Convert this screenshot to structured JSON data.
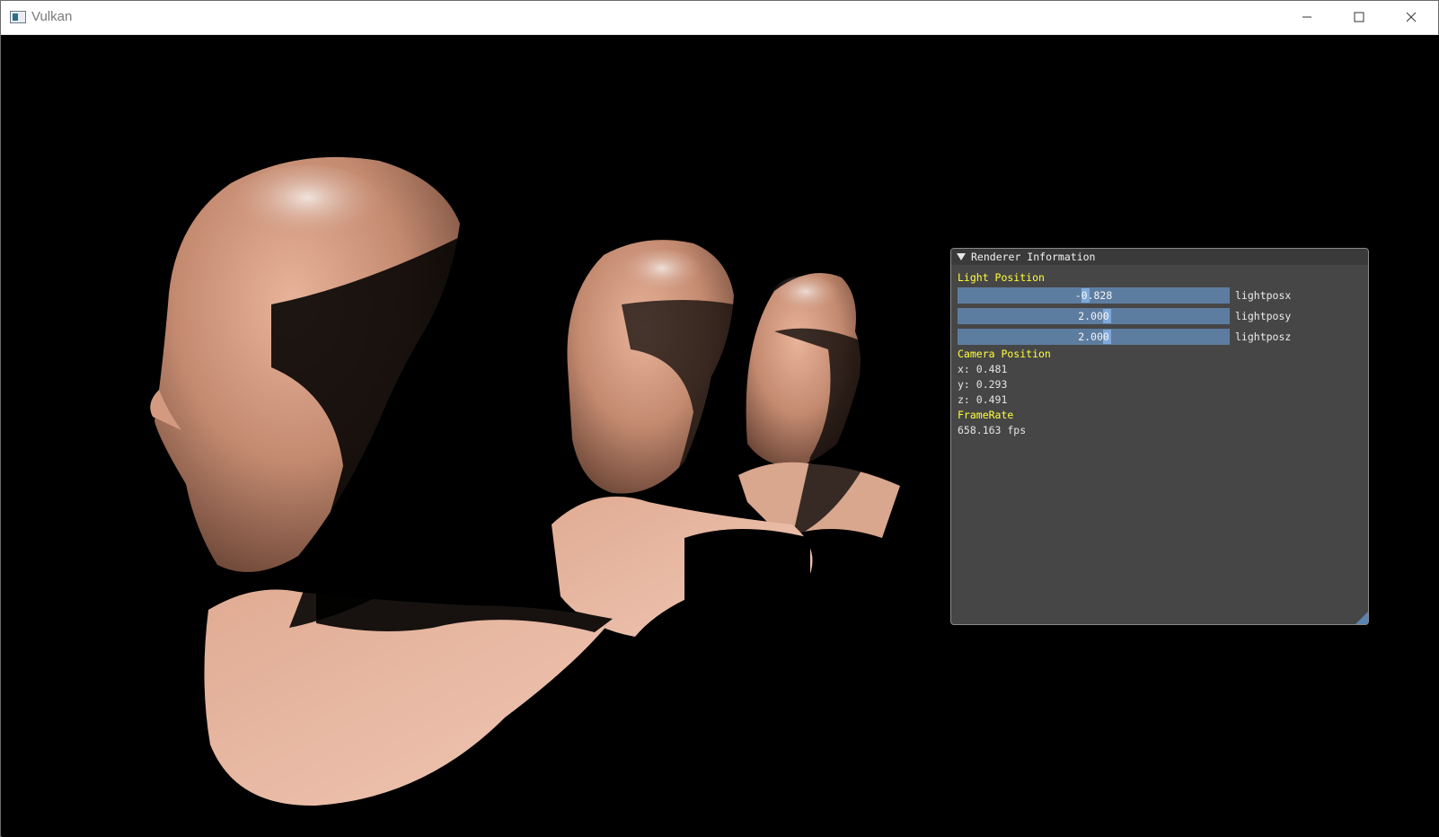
{
  "window": {
    "title": "Vulkan",
    "icon": "app-window-icon",
    "controls": [
      "minimize-icon",
      "maximize-icon",
      "close-icon"
    ]
  },
  "scene": {
    "description_icon": "head-models-render",
    "background_color": "#000000",
    "skin_color": "#c8937c"
  },
  "panel": {
    "title": "Renderer Information",
    "light_section": "Light Position",
    "sliders": [
      {
        "value": "-0.828",
        "label": "lightposx",
        "fraction": 0.47
      },
      {
        "value": "2.000",
        "label": "lightposy",
        "fraction": 0.55
      },
      {
        "value": "2.000",
        "label": "lightposz",
        "fraction": 0.55
      }
    ],
    "camera_section": "Camera Position",
    "camera": {
      "x": "x: 0.481",
      "y": "y: 0.293",
      "z": "z: 0.491"
    },
    "framerate_section": "FrameRate",
    "framerate": "658.163 fps",
    "colors": {
      "header_text": "#ffff3a",
      "slider_bg": "#5d7da0",
      "slider_grab": "#7ea9d9",
      "panel_bg": "#464646"
    }
  }
}
